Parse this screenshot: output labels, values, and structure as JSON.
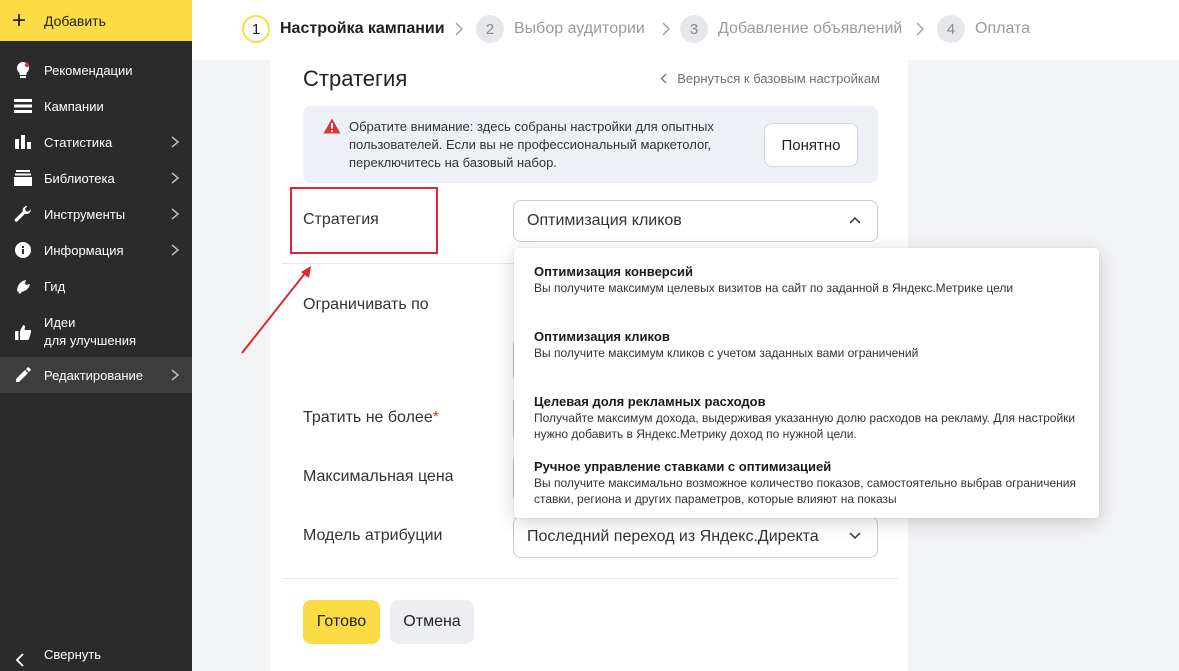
{
  "sidebar": {
    "add_label": "Добавить",
    "items": [
      {
        "label": "Рекомендации",
        "icon": "lightbulb-icon",
        "has_arrow": false
      },
      {
        "label": "Кампании",
        "icon": "list-icon",
        "has_arrow": false
      },
      {
        "label": "Статистика",
        "icon": "bar-chart-icon",
        "has_arrow": true
      },
      {
        "label": "Библиотека",
        "icon": "library-icon",
        "has_arrow": true
      },
      {
        "label": "Инструменты",
        "icon": "wrench-icon",
        "has_arrow": true
      },
      {
        "label": "Информация",
        "icon": "info-icon",
        "has_arrow": true
      },
      {
        "label": "Гид",
        "icon": "guide-icon",
        "has_arrow": false
      },
      {
        "label_line1": "Идеи",
        "label_line2": "для улучшения",
        "icon": "thumbs-up-icon",
        "has_arrow": false
      },
      {
        "label": "Редактирование",
        "icon": "pencil-icon",
        "has_arrow": true,
        "active": true
      }
    ],
    "collapse_label": "Свернуть"
  },
  "steps": [
    {
      "num": "1",
      "label": "Настройка кампании",
      "current": true
    },
    {
      "num": "2",
      "label": "Выбор аудитории",
      "current": false
    },
    {
      "num": "3",
      "label": "Добавление объявлений",
      "current": false
    },
    {
      "num": "4",
      "label": "Оплата",
      "current": false
    }
  ],
  "panel": {
    "title": "Стратегия",
    "back_link": "Вернуться к базовым настройкам",
    "notice": {
      "text": "Обратите внимание: здесь собраны настройки для опытных пользователей. Если вы не профессиональный маркетолог, переключитесь на базовый набор.",
      "button": "Понятно"
    },
    "fields": {
      "strategy_label": "Стратегия",
      "strategy_value": "Оптимизация кликов",
      "limit_label": "Ограничивать по",
      "spend_label": "Тратить не более",
      "spend_required": "*",
      "max_price_label": "Максимальная цена",
      "attribution_label": "Модель атрибуции",
      "attribution_value": "Последний переход из Яндекс.Директа"
    },
    "done_button": "Готово",
    "cancel_button": "Отмена"
  },
  "dropdown": {
    "options": [
      {
        "title": "Оптимизация конверсий",
        "desc": "Вы получите максимум целевых визитов на сайт по заданной в Яндекс.Метрике цели"
      },
      {
        "title": "Оптимизация кликов",
        "desc": "Вы получите максимум кликов с учетом заданных вами ограничений"
      },
      {
        "title": "Целевая доля рекламных расходов",
        "desc": "Получайте максимум дохода, выдерживая указанную долю расходов на рекламу. Для настройки нужно добавить в Яндекс.Метрику доход по нужной цели."
      },
      {
        "title": "Ручное управление ставками с оптимизацией",
        "desc": "Вы получите максимально возможное количество показов, самостоятельно выбрав ограничения ставки, региона и других параметров, которые влияют на показы"
      }
    ]
  },
  "colors": {
    "accent_yellow": "#fcdc45",
    "sidebar_bg": "#2b2b2b",
    "highlight_red": "#e0262d",
    "warning_red": "#e0323a"
  }
}
